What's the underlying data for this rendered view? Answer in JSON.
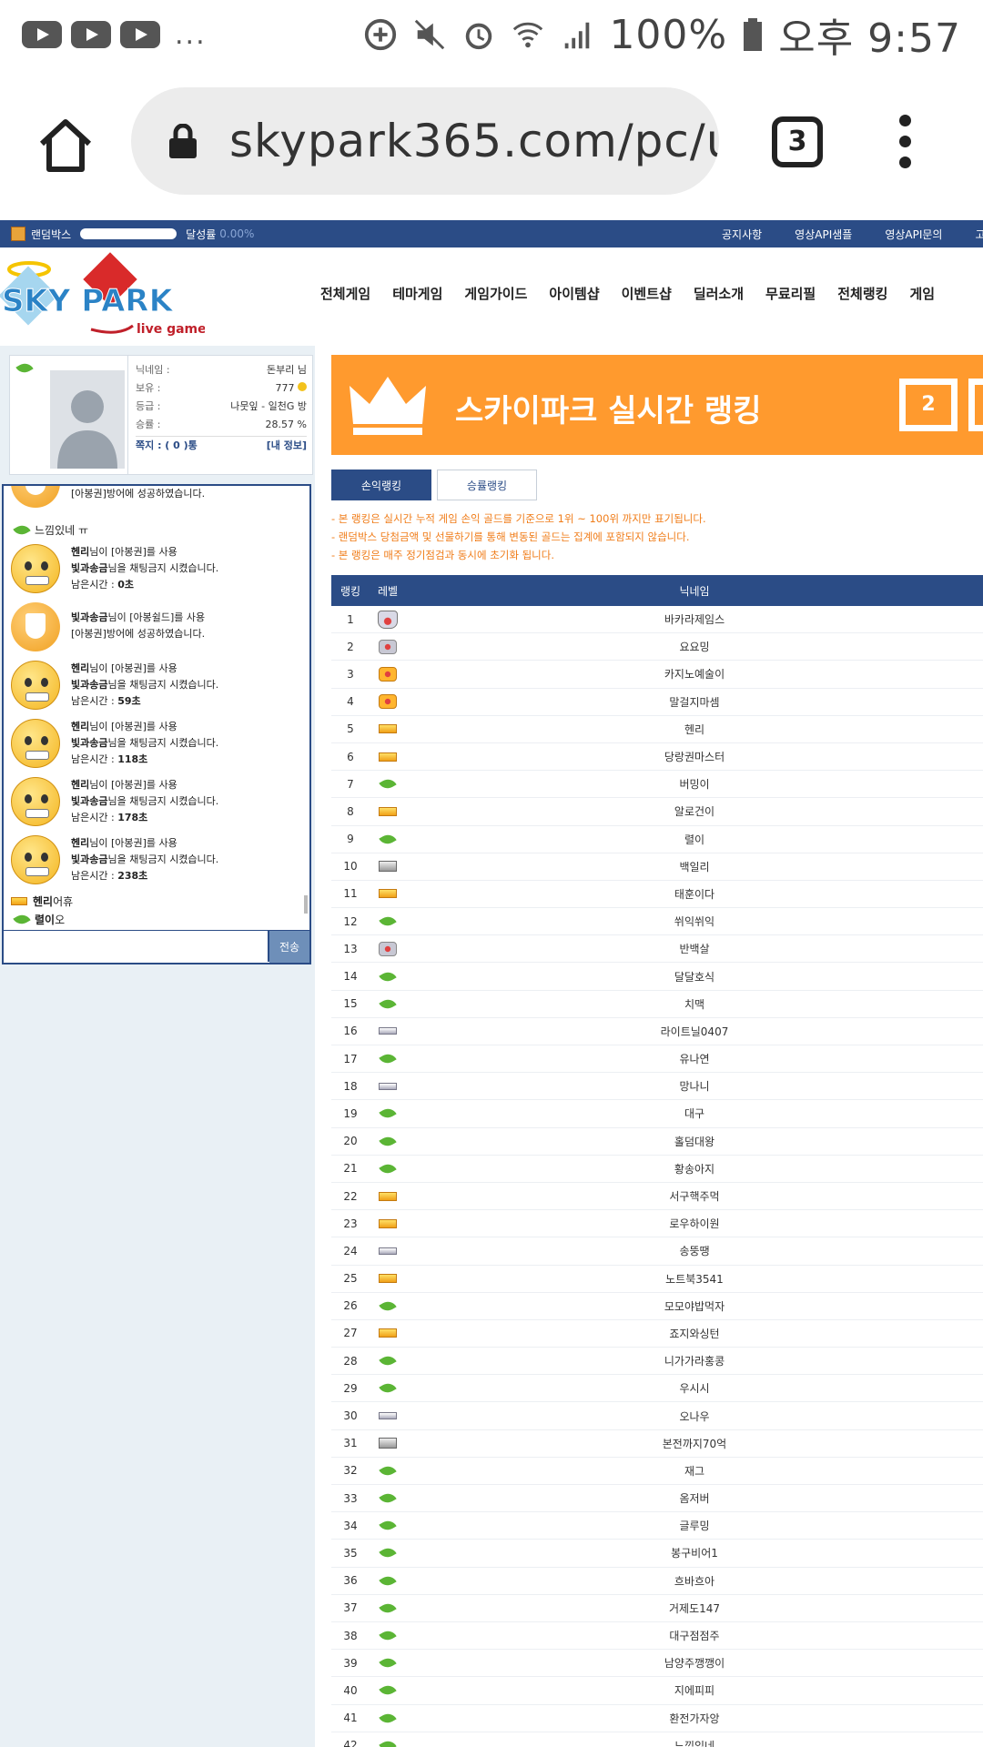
{
  "status_bar": {
    "battery": "100%",
    "time": "오후 9:57",
    "more": "..."
  },
  "browser": {
    "url": "skypark365.com/pc/use",
    "tab_count": "3"
  },
  "top_strip": {
    "random_box": "랜덤박스",
    "achievement_label": "달성률",
    "achievement_value": "0.00%",
    "achievement_fill": 0.0,
    "links": [
      "공지사항",
      "영상API샘플",
      "영상API문의",
      "고"
    ]
  },
  "nav": [
    "전체게임",
    "테마게임",
    "게임가이드",
    "아이템샵",
    "이벤트샵",
    "딜러소개",
    "무료리필",
    "전체랭킹",
    "게임"
  ],
  "logo": {
    "line1": "SKY PARK",
    "line2": "live games"
  },
  "profile": {
    "nick_label": "닉네임 :",
    "nick_value": "돈부리 님",
    "hold_label": "보유 :",
    "hold_value": "777",
    "grade_label": "등급 :",
    "grade_value": "나뭇잎 - 일천G 방",
    "win_label": "승률 :",
    "win_value": "28.57 %",
    "msg_label": "쪽지 : ( 0 )통",
    "my_info": "[내 정보]"
  },
  "chat": {
    "partial": "[아봉권]방어에 성공하였습니다.",
    "leaf_line": "느낌있네 ㅠ",
    "messages": [
      {
        "l1a": "헨리",
        "l1b": "님이 [아봉권]를 사용",
        "l2a": "빛과송금",
        "l2b": "님을 채팅금지 시켰습니다.",
        "l3a": "남은시간 : ",
        "l3b": "0초"
      },
      {
        "l1a": "빛과송금",
        "l1b": "님이 [아봉쉴드]를 사용",
        "l2a": "",
        "l2b": "[아봉권]방어에 성공하였습니다.",
        "l3a": "",
        "l3b": ""
      },
      {
        "l1a": "헨리",
        "l1b": "님이 [아봉권]를 사용",
        "l2a": "빛과송금",
        "l2b": "님을 채팅금지 시켰습니다.",
        "l3a": "남은시간 : ",
        "l3b": "59초"
      },
      {
        "l1a": "헨리",
        "l1b": "님이 [아봉권]를 사용",
        "l2a": "빛과송금",
        "l2b": "님을 채팅금지 시켰습니다.",
        "l3a": "남은시간 : ",
        "l3b": "118초"
      },
      {
        "l1a": "헨리",
        "l1b": "님이 [아봉권]를 사용",
        "l2a": "빛과송금",
        "l2b": "님을 채팅금지 시켰습니다.",
        "l3a": "남은시간 : ",
        "l3b": "178초"
      },
      {
        "l1a": "헨리",
        "l1b": "님이 [아봉권]를 사용",
        "l2a": "빛과송금",
        "l2b": "님을 채팅금지 시켰습니다.",
        "l3a": "남은시간 : ",
        "l3b": "238초"
      }
    ],
    "line_a_name": "헨리",
    "line_a_text": " 어휴",
    "line_b_name": "렬이",
    "line_b_text": " 오",
    "send": "전송"
  },
  "ranking": {
    "banner_title": "스카이파크 실시간 랭킹",
    "banner_num": "2",
    "tab_profit": "손익랭킹",
    "tab_win": "승률랭킹",
    "notes": [
      "- 본 랭킹은 실시간 누적 게임 손익 골드를 기준으로 1위 ~ 100위 까지만 표기됩니다.",
      "- 랜덤박스 당첨금액 및 선물하기를 통해 변동된 골드는 집계에 포함되지 않습니다.",
      "- 본 랭킹은 매주 정기점검과 동시에 초기화 됩니다."
    ],
    "col_rank": "랭킹",
    "col_level": "레벨",
    "col_nick": "닉네임",
    "rows": [
      {
        "rank": "1",
        "level": "crown",
        "nick": "바카라제임스"
      },
      {
        "rank": "2",
        "level": "badge",
        "nick": "요요밍"
      },
      {
        "rank": "3",
        "level": "orange",
        "nick": "카지노예술이"
      },
      {
        "rank": "4",
        "level": "orange",
        "nick": "말걸지마셈"
      },
      {
        "rank": "5",
        "level": "gold",
        "nick": "헨리"
      },
      {
        "rank": "6",
        "level": "gold",
        "nick": "당랑권마스터"
      },
      {
        "rank": "7",
        "level": "leaf",
        "nick": "버밍이"
      },
      {
        "rank": "8",
        "level": "gold",
        "nick": "알로건이"
      },
      {
        "rank": "9",
        "level": "leaf",
        "nick": "렬이"
      },
      {
        "rank": "10",
        "level": "metal",
        "nick": "백일리"
      },
      {
        "rank": "11",
        "level": "gold",
        "nick": "태훈이다"
      },
      {
        "rank": "12",
        "level": "leaf",
        "nick": "쒸익쒸익"
      },
      {
        "rank": "13",
        "level": "badge",
        "nick": "반백살"
      },
      {
        "rank": "14",
        "level": "leaf",
        "nick": "달달호식"
      },
      {
        "rank": "15",
        "level": "leaf",
        "nick": "치맥"
      },
      {
        "rank": "16",
        "level": "silver",
        "nick": "라이트닐0407"
      },
      {
        "rank": "17",
        "level": "leaf",
        "nick": "유나연"
      },
      {
        "rank": "18",
        "level": "silver",
        "nick": "망나니"
      },
      {
        "rank": "19",
        "level": "leaf",
        "nick": "대구"
      },
      {
        "rank": "20",
        "level": "leaf",
        "nick": "홀덤대왕"
      },
      {
        "rank": "21",
        "level": "leaf",
        "nick": "황송아지"
      },
      {
        "rank": "22",
        "level": "gold",
        "nick": "서구핵주먹"
      },
      {
        "rank": "23",
        "level": "gold",
        "nick": "로우하이원"
      },
      {
        "rank": "24",
        "level": "silver",
        "nick": "송뚱땡"
      },
      {
        "rank": "25",
        "level": "gold",
        "nick": "노트북3541"
      },
      {
        "rank": "26",
        "level": "leaf",
        "nick": "모모야밥먹자"
      },
      {
        "rank": "27",
        "level": "gold",
        "nick": "죠지와싱턴"
      },
      {
        "rank": "28",
        "level": "leaf",
        "nick": "니가가라홍콩"
      },
      {
        "rank": "29",
        "level": "leaf",
        "nick": "우시시"
      },
      {
        "rank": "30",
        "level": "silver",
        "nick": "오나우"
      },
      {
        "rank": "31",
        "level": "metal",
        "nick": "본전까지70억"
      },
      {
        "rank": "32",
        "level": "leaf",
        "nick": "재그"
      },
      {
        "rank": "33",
        "level": "leaf",
        "nick": "옴저버"
      },
      {
        "rank": "34",
        "level": "leaf",
        "nick": "글루밍"
      },
      {
        "rank": "35",
        "level": "leaf",
        "nick": "봉구비어1"
      },
      {
        "rank": "36",
        "level": "leaf",
        "nick": "흐바흐아"
      },
      {
        "rank": "37",
        "level": "leaf",
        "nick": "거제도147"
      },
      {
        "rank": "38",
        "level": "leaf",
        "nick": "대구점점주"
      },
      {
        "rank": "39",
        "level": "leaf",
        "nick": "남양주깽깽이"
      },
      {
        "rank": "40",
        "level": "leaf",
        "nick": "지에피피"
      },
      {
        "rank": "41",
        "level": "leaf",
        "nick": "환전가자앙"
      },
      {
        "rank": "42",
        "level": "leaf",
        "nick": "느낌있네"
      }
    ]
  }
}
